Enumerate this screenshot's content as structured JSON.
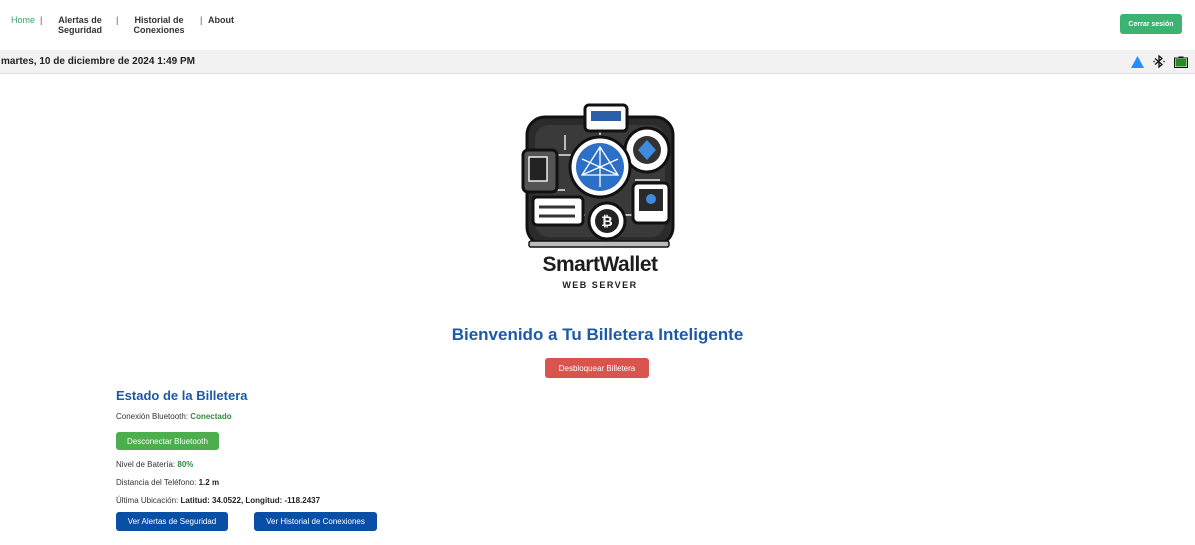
{
  "nav": {
    "home": "Home",
    "alerts": "Alertas de Seguridad",
    "history": "Historial de Conexiones",
    "about": "About",
    "logout": "Cerrar sesión"
  },
  "statusbar": {
    "datetime": "martes, 10 de diciembre de 2024 1:49 PM",
    "icons": [
      "wifi-signal-icon",
      "bluetooth-icon",
      "battery-icon"
    ],
    "colors": {
      "signal": "#1e90ff",
      "battery": "#228b22"
    }
  },
  "logo": {
    "title": "SmartWallet",
    "subtitle": "WEB SERVER"
  },
  "main": {
    "welcome": "Bienvenido a Tu Billetera Inteligente",
    "unlock_label": "Desbloquear Billetera"
  },
  "wallet": {
    "title": "Estado de la Billetera",
    "bluetooth_label": "Conexión Bluetooth:",
    "bluetooth_value": "Conectado",
    "disconnect_label": "Desconectar Bluetooth",
    "battery_label": "Nivel de Batería:",
    "battery_value": "80%",
    "distance_label": "Distancia del Teléfono:",
    "distance_value": "1.2 m",
    "location_label": "Última Ubicación:",
    "location_value": "Latitud: 34.0522, Longitud: -118.2437",
    "alerts_btn": "Ver Alertas de Seguridad",
    "history_btn": "Ver Historial de Conexiones"
  }
}
